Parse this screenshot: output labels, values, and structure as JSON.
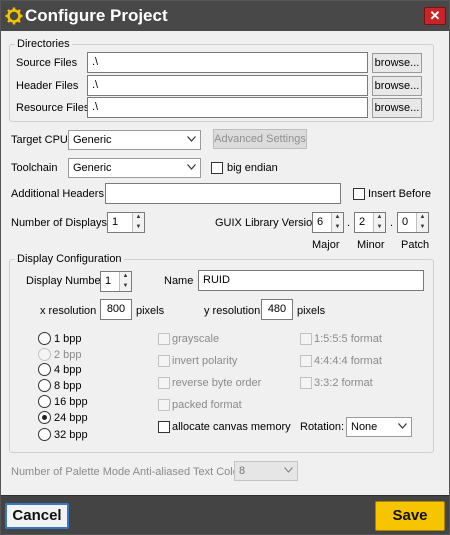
{
  "window": {
    "title": "Configure Project",
    "close": "✕"
  },
  "directories": {
    "legend": "Directories",
    "rows": [
      {
        "label": "Source Files",
        "value": ".\\",
        "button": "browse..."
      },
      {
        "label": "Header Files",
        "value": ".\\",
        "button": "browse..."
      },
      {
        "label": "Resource Files",
        "value": ".\\",
        "button": "browse..."
      }
    ]
  },
  "target_cpu": {
    "label": "Target CPU",
    "value": "Generic",
    "advanced_button": "Advanced Settings"
  },
  "toolchain": {
    "label": "Toolchain",
    "value": "Generic",
    "big_endian_label": "big endian",
    "big_endian_checked": false
  },
  "additional_headers": {
    "label": "Additional Headers",
    "value": "",
    "insert_before_label": "Insert Before",
    "insert_before_checked": false
  },
  "displays": {
    "label": "Number of Displays",
    "value": "1"
  },
  "guix": {
    "label": "GUIX Library Version",
    "major": "6",
    "minor": "2",
    "patch": "0",
    "major_label": "Major",
    "minor_label": "Minor",
    "patch_label": "Patch",
    "separator": "."
  },
  "display_config": {
    "legend": "Display Configuration",
    "number_label": "Display Number",
    "number_value": "1",
    "name_label": "Name",
    "name_value": "RUID",
    "xres_label": "x resolution",
    "xres_value": "800",
    "yres_label": "y resolution",
    "yres_value": "480",
    "pixels_label": "pixels",
    "bpp_options": [
      {
        "label": "1 bpp",
        "selected": false,
        "disabled": false
      },
      {
        "label": "2 bpp",
        "selected": false,
        "disabled": true
      },
      {
        "label": "4 bpp",
        "selected": false,
        "disabled": false
      },
      {
        "label": "8 bpp",
        "selected": false,
        "disabled": false
      },
      {
        "label": "16 bpp",
        "selected": false,
        "disabled": false
      },
      {
        "label": "24 bpp",
        "selected": true,
        "disabled": false
      },
      {
        "label": "32 bpp",
        "selected": false,
        "disabled": false
      }
    ],
    "options": {
      "grayscale": "grayscale",
      "invert_polarity": "invert polarity",
      "reverse_byte_order": "reverse byte order",
      "packed_format": "packed format",
      "allocate_canvas_memory": "allocate canvas memory"
    },
    "formats": {
      "f1555": "1:5:5:5 format",
      "f4444": "4:4:4:4 format",
      "f332": "3:3:2 format"
    },
    "rotation_label": "Rotation:",
    "rotation_value": "None"
  },
  "palette": {
    "label": "Number of Palette Mode Anti-aliased Text Colors:",
    "value": "8"
  },
  "footer": {
    "cancel": "Cancel",
    "save": "Save"
  },
  "colors": {
    "titlebar": "#484848",
    "close": "#c8252a",
    "save": "#f7c400",
    "footer": "#444444",
    "cancel_border": "#3b78c4"
  }
}
